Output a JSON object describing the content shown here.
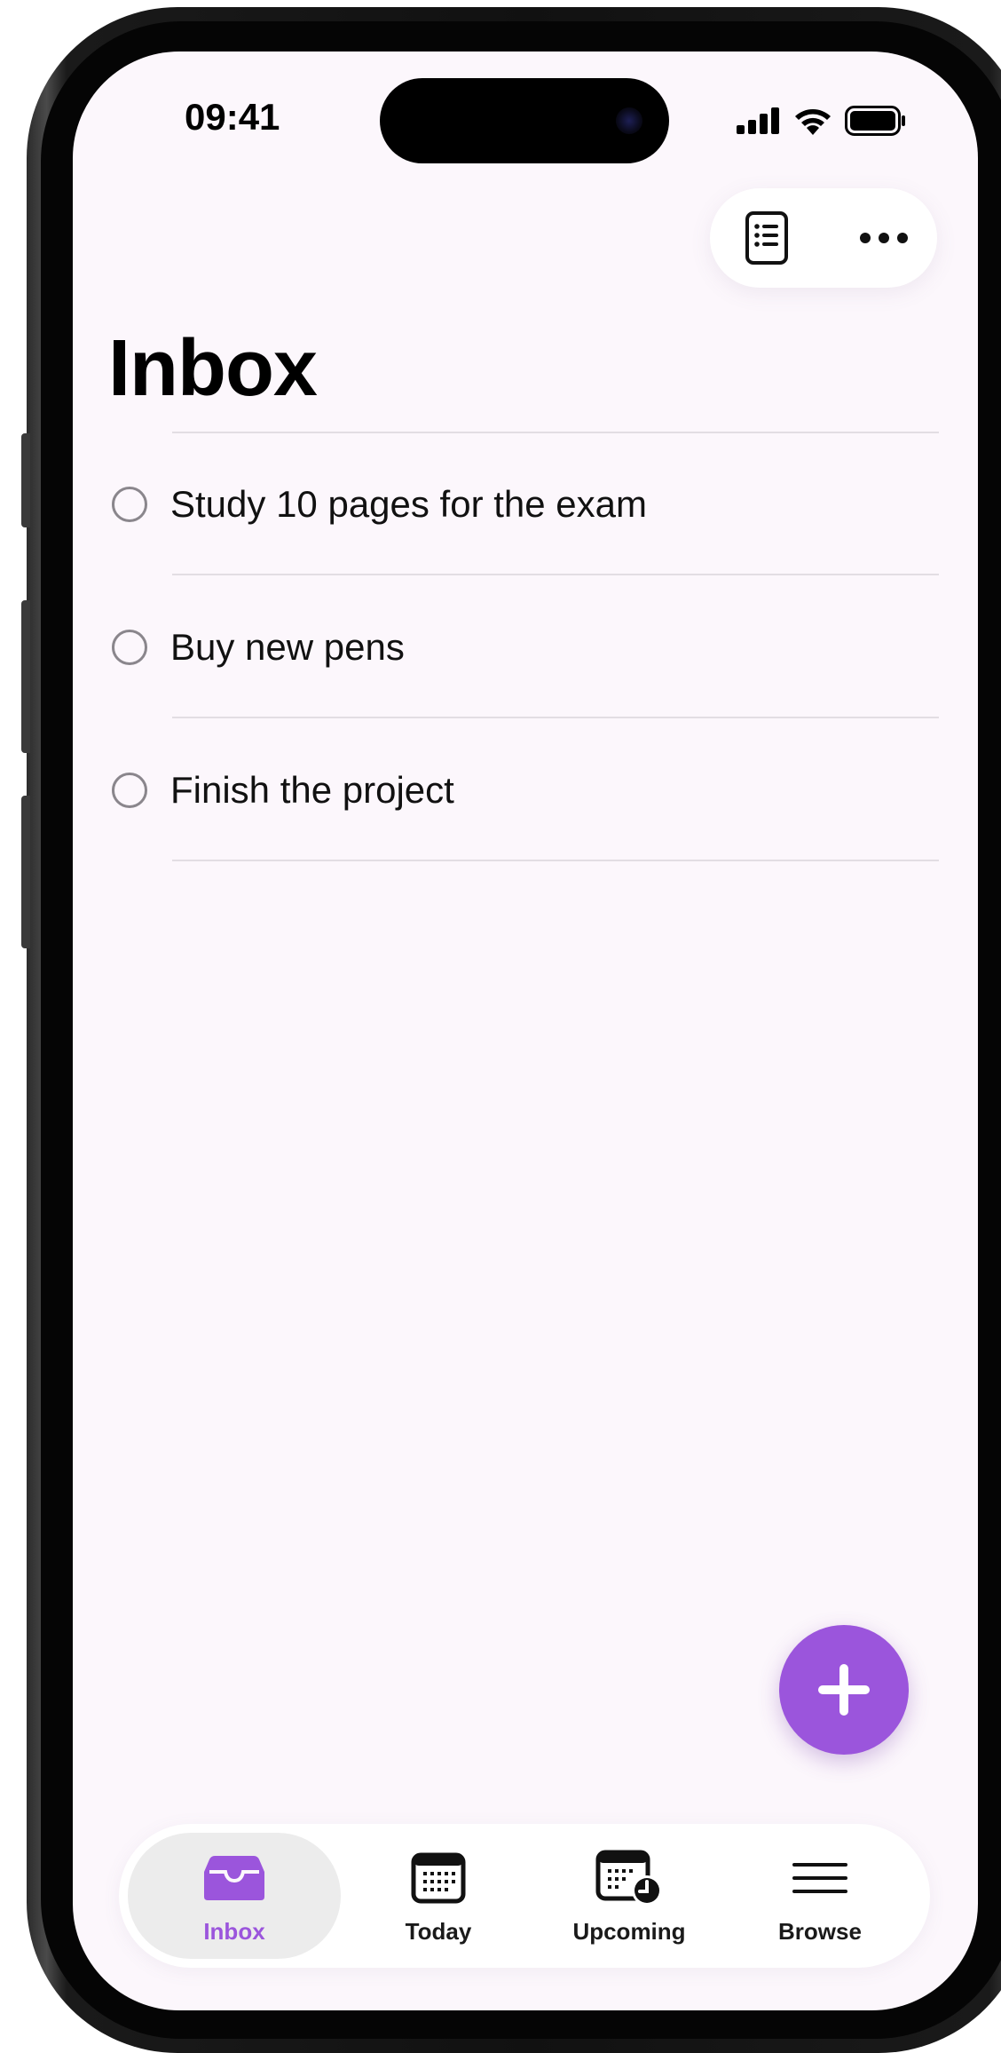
{
  "status_bar": {
    "time": "09:41"
  },
  "toolbar": {
    "view_icon": "list-view-icon",
    "more_icon": "ellipsis-icon"
  },
  "page": {
    "title": "Inbox"
  },
  "tasks": [
    {
      "label": "Study 10 pages for the exam"
    },
    {
      "label": "Buy new pens"
    },
    {
      "label": "Finish the project"
    }
  ],
  "fab": {
    "icon": "plus-icon"
  },
  "tabs": [
    {
      "label": "Inbox",
      "icon": "inbox-tray-icon",
      "active": true
    },
    {
      "label": "Today",
      "icon": "calendar-icon",
      "active": false
    },
    {
      "label": "Upcoming",
      "icon": "calendar-clock-icon",
      "active": false
    },
    {
      "label": "Browse",
      "icon": "menu-lines-icon",
      "active": false
    }
  ],
  "colors": {
    "accent": "#9b55dc",
    "background": "#fcf7fc"
  }
}
